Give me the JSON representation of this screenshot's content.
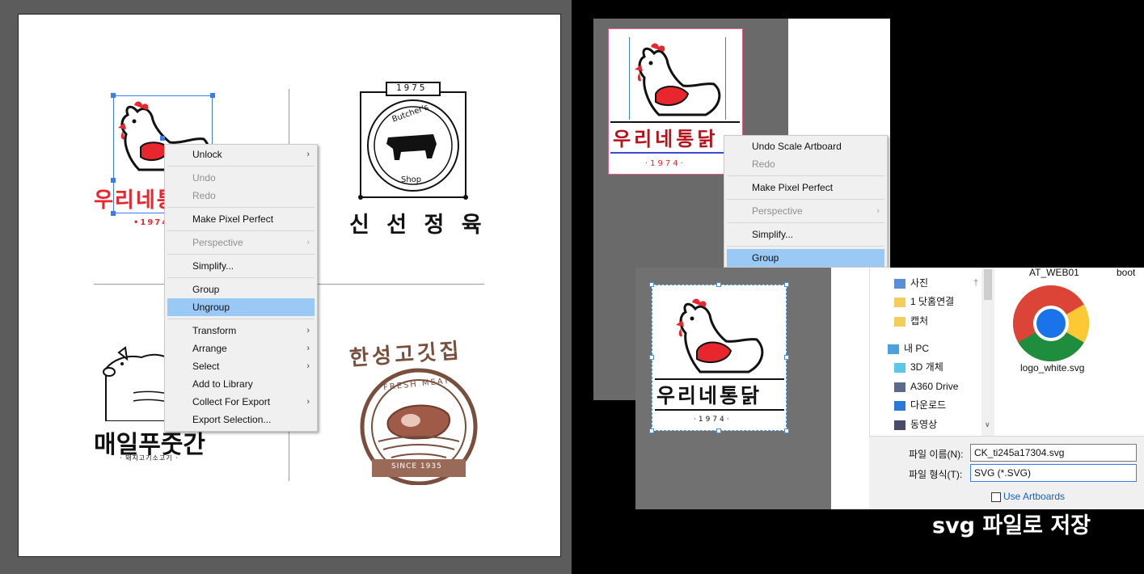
{
  "left": {
    "logos": {
      "chicken_partial_text": "우리네통닭",
      "chicken_partial_year": "•1974•",
      "butcher_year": "1975",
      "butcher_arc": "Butcher's",
      "butcher_shop": "Shop",
      "butcher_title": "신 선 정 육",
      "pig_title": "매일푸줏간",
      "pig_subtitle": "· 돼지고기소고기 ·",
      "meat_arc_title": "한성고깃집",
      "meat_inner_arc": "FRESH MEAT",
      "meat_ribbon": "SINCE 1935"
    },
    "context_menu": {
      "items": [
        {
          "label": "Unlock",
          "submenu": true,
          "disabled": false
        },
        {
          "sep": true
        },
        {
          "label": "Undo",
          "disabled": true
        },
        {
          "label": "Redo",
          "disabled": true
        },
        {
          "sep": true
        },
        {
          "label": "Make Pixel Perfect",
          "disabled": false
        },
        {
          "sep": true
        },
        {
          "label": "Perspective",
          "submenu": true,
          "disabled": true
        },
        {
          "sep": true
        },
        {
          "label": "Simplify...",
          "disabled": false
        },
        {
          "sep": true
        },
        {
          "label": "Group",
          "disabled": false
        },
        {
          "label": "Ungroup",
          "disabled": false,
          "highlighted": true
        },
        {
          "sep": true
        },
        {
          "label": "Transform",
          "submenu": true,
          "disabled": false
        },
        {
          "label": "Arrange",
          "submenu": true,
          "disabled": false
        },
        {
          "label": "Select",
          "submenu": true,
          "disabled": false
        },
        {
          "label": "Add to Library",
          "disabled": false
        },
        {
          "label": "Collect For Export",
          "submenu": true,
          "disabled": false
        },
        {
          "label": "Export Selection...",
          "disabled": false
        }
      ]
    }
  },
  "right": {
    "logo_text": "우리네통닭",
    "logo_year": "·1974·",
    "context_menu": {
      "items": [
        {
          "label": "Undo Scale Artboard",
          "disabled": false
        },
        {
          "label": "Redo",
          "disabled": true
        },
        {
          "sep": true
        },
        {
          "label": "Make Pixel Perfect",
          "disabled": false
        },
        {
          "sep": true
        },
        {
          "label": "Perspective",
          "submenu": true,
          "disabled": true
        },
        {
          "sep": true
        },
        {
          "label": "Simplify...",
          "disabled": false
        },
        {
          "sep": true
        },
        {
          "label": "Group",
          "disabled": false,
          "highlighted": true
        }
      ]
    },
    "dialog": {
      "nav_items": [
        {
          "label": "사진",
          "icon": "pictures-icon",
          "pinned": true
        },
        {
          "label": "1 닷홈연결",
          "icon": "folder-icon"
        },
        {
          "label": "캡처",
          "icon": "folder-icon"
        },
        {
          "label": "내 PC",
          "icon": "pc-icon"
        },
        {
          "label": "3D 개체",
          "icon": "3d-objects-icon"
        },
        {
          "label": "A360 Drive",
          "icon": "a360-drive-icon"
        },
        {
          "label": "다운로드",
          "icon": "download-icon"
        },
        {
          "label": "동영상",
          "icon": "videos-icon"
        }
      ],
      "file_tiles": [
        {
          "label": "AT_WEB01"
        },
        {
          "label": "boot"
        },
        {
          "label": "logo_white.svg",
          "icon": "chrome-icon"
        }
      ],
      "filename_label": "파일 이름(N):",
      "filename_value": "CK_ti245a17304.svg",
      "filetype_label": "파일 형식(T):",
      "filetype_value": "SVG (*.SVG)",
      "use_artboards_label": "Use Artboards",
      "use_artboards_checked": false
    },
    "caption": "svg 파일로 저장"
  },
  "colors": {
    "chicken_red": "#e8262d",
    "meat_brown": "#7a4e3c",
    "selection_blue": "#3b7cf5",
    "menu_highlight": "#99c9f4"
  }
}
